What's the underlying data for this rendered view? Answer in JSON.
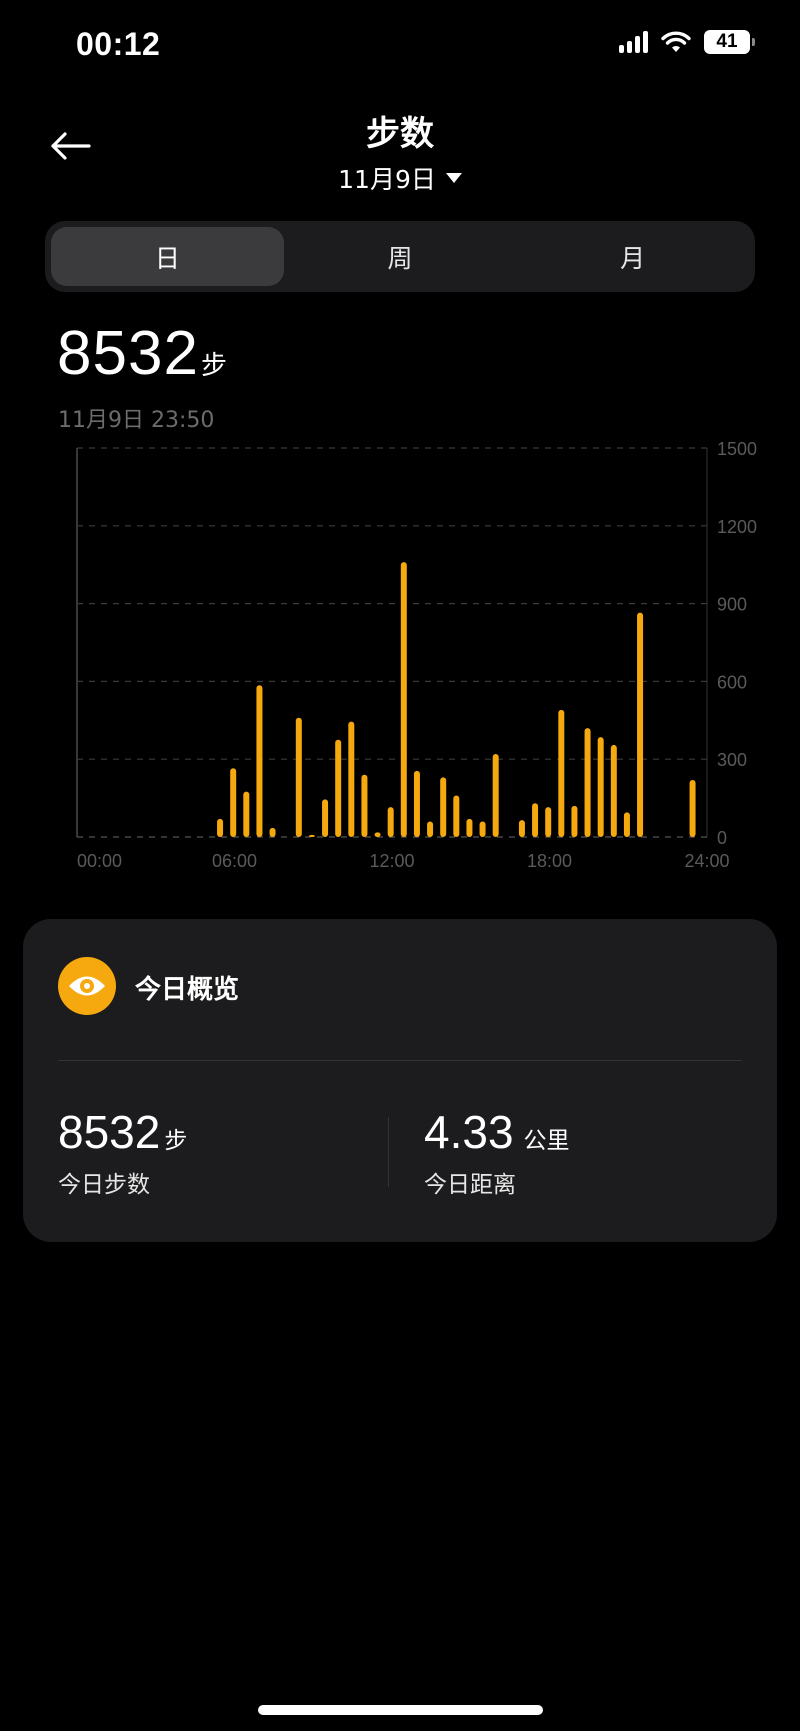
{
  "status_bar": {
    "time": "00:12",
    "battery": "41"
  },
  "header": {
    "title": "步数",
    "date": "11月9日"
  },
  "tabs": [
    {
      "label": "日",
      "active": true
    },
    {
      "label": "周",
      "active": false
    },
    {
      "label": "月",
      "active": false
    }
  ],
  "summary": {
    "steps": "8532",
    "unit": "步",
    "timestamp": "11月9日 23:50"
  },
  "colors": {
    "accent": "#f5a90e",
    "background": "#000000",
    "card": "#1c1c1e"
  },
  "chart_data": {
    "type": "bar",
    "x_ticks": [
      "00:00",
      "06:00",
      "12:00",
      "18:00",
      "24:00"
    ],
    "y_ticks": [
      "0",
      "300",
      "600",
      "900",
      "1200",
      "1500"
    ],
    "ylim": [
      0,
      1500
    ],
    "xlim": [
      0,
      24
    ],
    "grid": true,
    "bars": [
      {
        "x": 5.45,
        "value": 70
      },
      {
        "x": 5.95,
        "value": 265
      },
      {
        "x": 6.45,
        "value": 175
      },
      {
        "x": 6.95,
        "value": 585
      },
      {
        "x": 7.45,
        "value": 35
      },
      {
        "x": 8.45,
        "value": 460
      },
      {
        "x": 8.95,
        "value": 8
      },
      {
        "x": 9.45,
        "value": 145
      },
      {
        "x": 9.95,
        "value": 375
      },
      {
        "x": 10.45,
        "value": 445
      },
      {
        "x": 10.95,
        "value": 240
      },
      {
        "x": 11.45,
        "value": 18
      },
      {
        "x": 11.95,
        "value": 115
      },
      {
        "x": 12.45,
        "value": 1060
      },
      {
        "x": 12.95,
        "value": 255
      },
      {
        "x": 13.45,
        "value": 60
      },
      {
        "x": 13.95,
        "value": 230
      },
      {
        "x": 14.45,
        "value": 160
      },
      {
        "x": 14.95,
        "value": 70
      },
      {
        "x": 15.45,
        "value": 60
      },
      {
        "x": 15.95,
        "value": 320
      },
      {
        "x": 16.95,
        "value": 65
      },
      {
        "x": 17.45,
        "value": 130
      },
      {
        "x": 17.95,
        "value": 115
      },
      {
        "x": 18.45,
        "value": 490
      },
      {
        "x": 18.95,
        "value": 120
      },
      {
        "x": 19.45,
        "value": 420
      },
      {
        "x": 19.95,
        "value": 385
      },
      {
        "x": 20.45,
        "value": 355
      },
      {
        "x": 20.95,
        "value": 95
      },
      {
        "x": 21.45,
        "value": 865
      },
      {
        "x": 23.45,
        "value": 220
      }
    ]
  },
  "overview": {
    "title": "今日概览",
    "steps_value": "8532",
    "steps_unit": "步",
    "steps_label": "今日步数",
    "distance_value": "4.33",
    "distance_unit": "公里",
    "distance_label": "今日距离"
  }
}
